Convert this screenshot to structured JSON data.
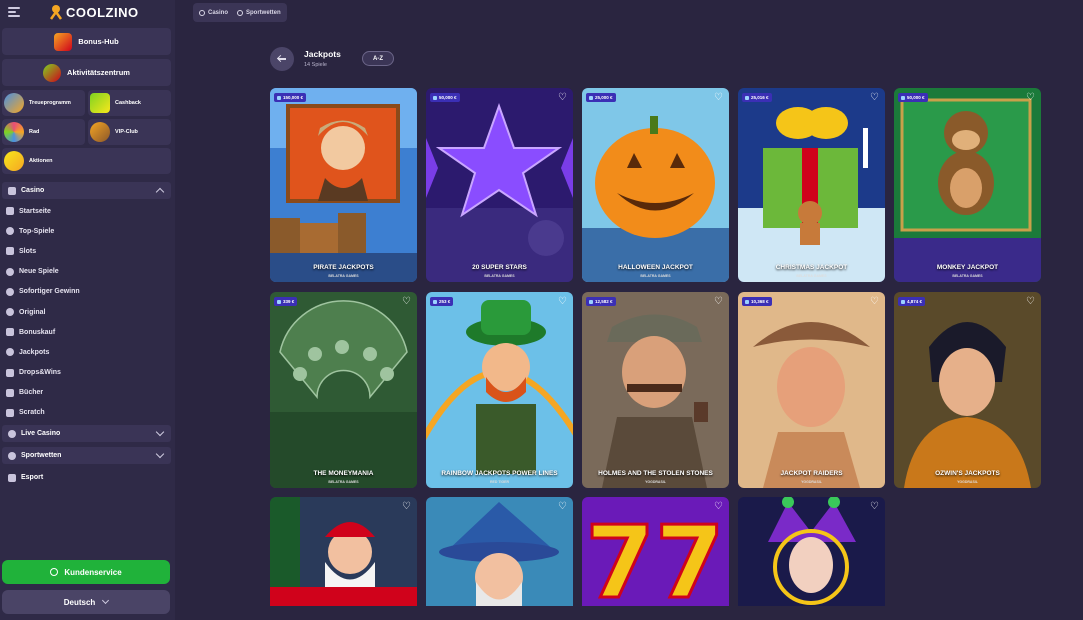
{
  "brand": {
    "name": "COOLZINO"
  },
  "sidebar": {
    "bonus_hub": "Bonus-Hub",
    "activity_center": "Aktivitätszentrum",
    "tiles": [
      "Treueprogramm",
      "Cashback",
      "Rad",
      "VIP-Club",
      "Aktionen"
    ],
    "casino_section": "Casino",
    "casino_items": [
      "Startseite",
      "Top-Spiele",
      "Slots",
      "Neue Spiele",
      "Sofortiger Gewinn",
      "Original",
      "Bonuskauf",
      "Jackpots",
      "Drops&Wins",
      "Bücher",
      "Scratch"
    ],
    "live_casino": "Live Casino",
    "sportwetten": "Sportwetten",
    "esport": "Esport",
    "support_label": "Kundenservice",
    "language": "Deutsch"
  },
  "top_tabs": [
    "Casino",
    "Sportwetten"
  ],
  "header": {
    "title": "Jackpots",
    "subtitle": "14 Spiele",
    "sort_label": "A-Z"
  },
  "games": [
    {
      "title": "PIRATE JACKPOTS",
      "provider": "BELATRA GAMES",
      "jackpot": "150,000 €"
    },
    {
      "title": "20 SUPER STARS",
      "provider": "BELATRA GAMES",
      "jackpot": "50,000 €"
    },
    {
      "title": "HALLOWEEN JACKPOT",
      "provider": "BELATRA GAMES",
      "jackpot": "25,000 €"
    },
    {
      "title": "CHRISTMAS JACKPOT",
      "provider": "BELATRA GAMES",
      "jackpot": "25,016 €"
    },
    {
      "title": "MONKEY JACKPOT",
      "provider": "BELATRA GAMES",
      "jackpot": "50,000 €"
    },
    {
      "title": "THE MONEYMANIA",
      "provider": "BELATRA GAMES",
      "jackpot": "339 €"
    },
    {
      "title": "RAINBOW JACKPOTS POWER LINES",
      "provider": "RED TIGER",
      "jackpot": "253 €"
    },
    {
      "title": "HOLMES AND THE STOLEN STONES",
      "provider": "YGGDRASIL",
      "jackpot": "12,582 €"
    },
    {
      "title": "JACKPOT RAIDERS",
      "provider": "YGGDRASIL",
      "jackpot": "10,368 €"
    },
    {
      "title": "OZWIN'S JACKPOTS",
      "provider": "YGGDRASIL",
      "jackpot": "4,874 €"
    },
    {
      "title": "",
      "provider": "",
      "jackpot": ""
    },
    {
      "title": "",
      "provider": "",
      "jackpot": ""
    },
    {
      "title": "",
      "provider": "",
      "jackpot": ""
    },
    {
      "title": "",
      "provider": "",
      "jackpot": ""
    }
  ],
  "colors": {
    "background": "#2a2540",
    "sidebar": "#2f2a47",
    "support": "#20b23a",
    "badge": "#3b2fb5"
  }
}
